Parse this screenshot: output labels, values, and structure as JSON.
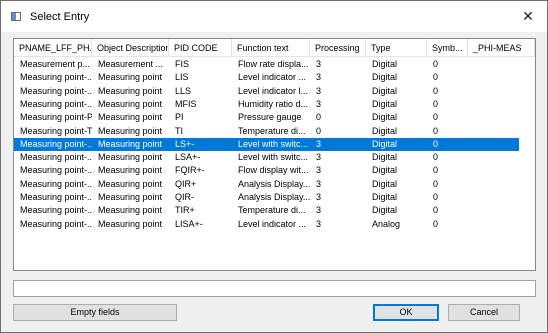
{
  "window": {
    "title": "Select Entry"
  },
  "columns": [
    "PNAME_LFF_PH...",
    "Object Description",
    "PID CODE",
    "Function text",
    "Processing",
    "Type",
    "Symb...",
    "_PHI-MEAS"
  ],
  "rows": [
    [
      "Measurement p...",
      "Measurement ...",
      "FIS",
      "Flow rate displa...",
      "3",
      "Digital",
      "0",
      ""
    ],
    [
      "Measuring point-...",
      "Measuring point",
      "LIS",
      "Level indicator ...",
      "3",
      "Digital",
      "0",
      ""
    ],
    [
      "Measuring point-...",
      "Measuring point",
      "LLS",
      "Level indicator l...",
      "3",
      "Digital",
      "0",
      ""
    ],
    [
      "Measuring point-...",
      "Measuring point",
      "MFIS",
      "Humidity ratio d...",
      "3",
      "Digital",
      "0",
      ""
    ],
    [
      "Measuring point-PI",
      "Measuring point",
      "PI",
      "Pressure gauge",
      "0",
      "Digital",
      "0",
      ""
    ],
    [
      "Measuring point-TI",
      "Measuring point",
      "TI",
      "Temperature di...",
      "0",
      "Digital",
      "0",
      ""
    ],
    [
      "Measuring point-...",
      "Measuring point",
      "LS+-",
      "Level with switc...",
      "3",
      "Digital",
      "0",
      ""
    ],
    [
      "Measuring point-...",
      "Measuring point",
      "LSA+-",
      "Level with switc...",
      "3",
      "Digital",
      "0",
      ""
    ],
    [
      "Measuring point-...",
      "Measuring point",
      "FQIR+-",
      "Flow display wit...",
      "3",
      "Digital",
      "0",
      ""
    ],
    [
      "Measuring point-...",
      "Measuring point",
      "QIR+",
      "Analysis Display...",
      "3",
      "Digital",
      "0",
      ""
    ],
    [
      "Measuring point-...",
      "Measuring point",
      "QIR-",
      "Analysis Display...",
      "3",
      "Digital",
      "0",
      ""
    ],
    [
      "Measuring point-...",
      "Measuring point",
      "TIR+",
      "Temperature di...",
      "3",
      "Digital",
      "0",
      ""
    ],
    [
      "Measuring point-...",
      "Measuring point",
      "LISA+-",
      "Level indicator ...",
      "3",
      "Analog",
      "0",
      ""
    ]
  ],
  "selected_row": 6,
  "edit_field": {
    "value": ""
  },
  "buttons": {
    "empty_fields": "Empty fields",
    "ok": "OK",
    "cancel": "Cancel"
  },
  "colors": {
    "selection": "#0078d7",
    "default_button_border": "#0078d7"
  }
}
